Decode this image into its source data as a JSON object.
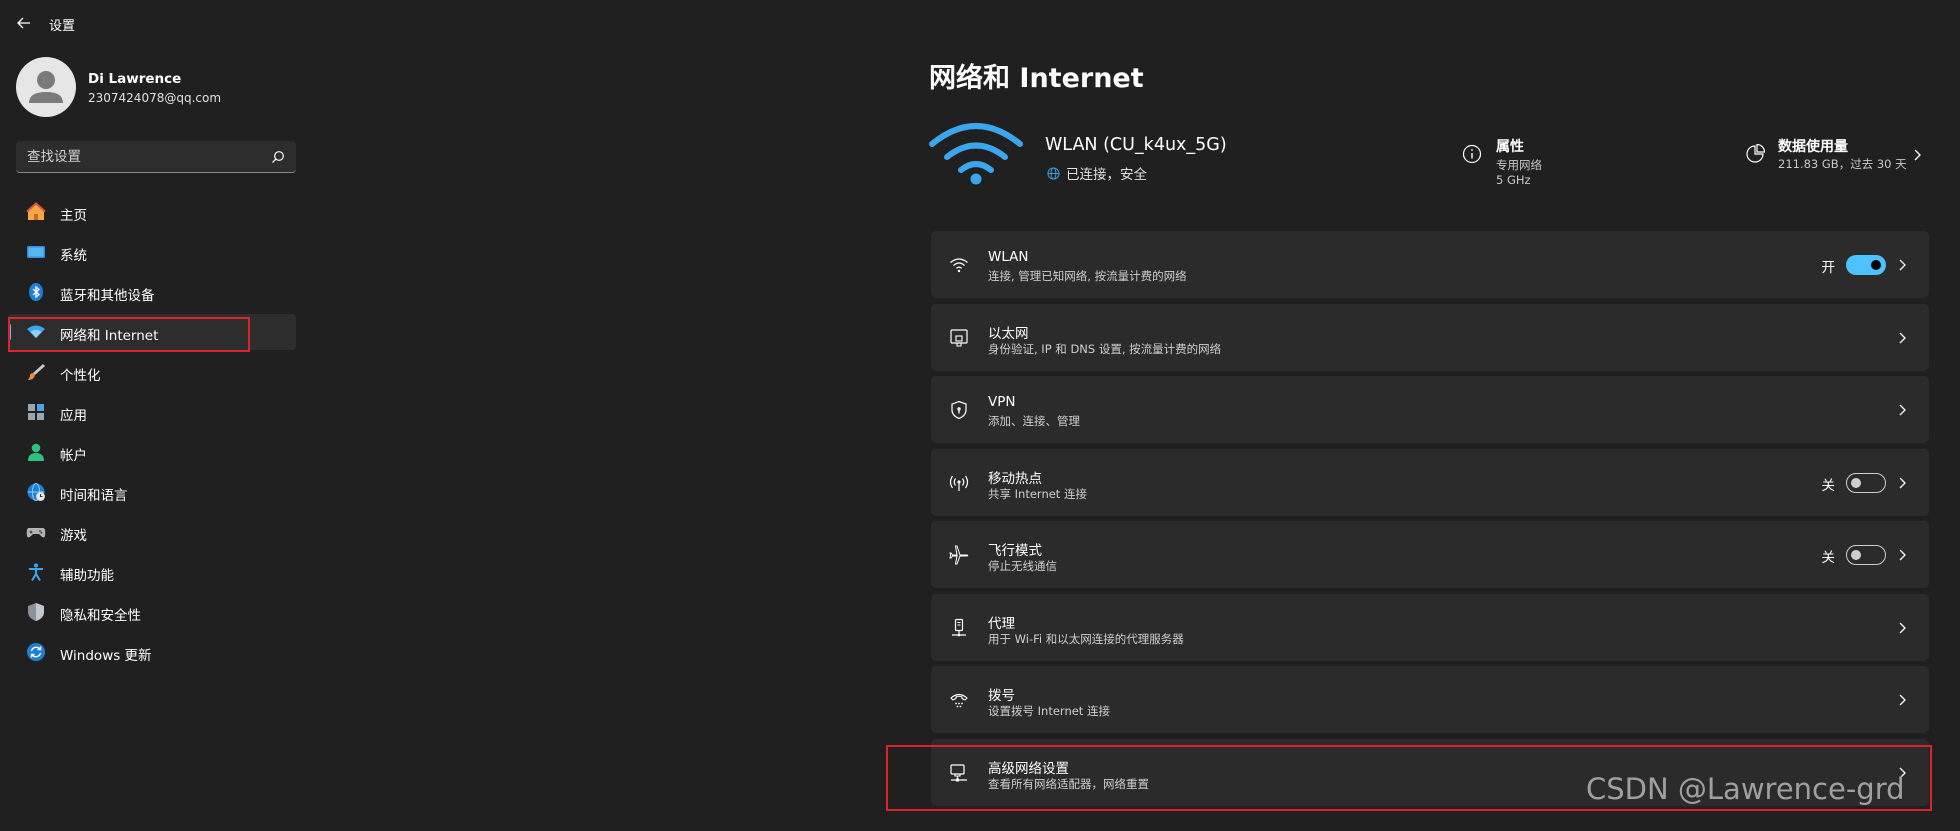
{
  "app": {
    "title": "设置"
  },
  "user": {
    "name": "Di Lawrence",
    "email": "2307424078@qq.com"
  },
  "search": {
    "placeholder": "查找设置"
  },
  "nav": {
    "items": [
      {
        "label": "主页",
        "icon": "home-icon"
      },
      {
        "label": "系统",
        "icon": "system-icon"
      },
      {
        "label": "蓝牙和其他设备",
        "icon": "bluetooth-icon"
      },
      {
        "label": "网络和 Internet",
        "icon": "network-icon",
        "active": true
      },
      {
        "label": "个性化",
        "icon": "brush-icon"
      },
      {
        "label": "应用",
        "icon": "apps-icon"
      },
      {
        "label": "帐户",
        "icon": "account-icon"
      },
      {
        "label": "时间和语言",
        "icon": "globe-clock-icon"
      },
      {
        "label": "游戏",
        "icon": "gamepad-icon"
      },
      {
        "label": "辅助功能",
        "icon": "accessibility-icon"
      },
      {
        "label": "隐私和安全性",
        "icon": "shield-icon"
      },
      {
        "label": "Windows 更新",
        "icon": "update-icon"
      }
    ]
  },
  "main": {
    "title": "网络和 Internet",
    "connection": {
      "name": "WLAN (CU_k4ux_5G)",
      "status": "已连接，安全"
    },
    "properties": {
      "title": "属性",
      "line1": "专用网络",
      "line2": "5 GHz"
    },
    "data_usage": {
      "title": "数据使用量",
      "value": "211.83 GB，过去 30 天"
    },
    "cards": [
      {
        "title": "WLAN",
        "subtitle": "连接, 管理已知网络, 按流量计费的网络",
        "icon": "wifi-icon",
        "toggle": true,
        "toggle_on": true,
        "toggle_label": "开"
      },
      {
        "title": "以太网",
        "subtitle": "身份验证, IP 和 DNS 设置, 按流量计费的网络",
        "icon": "ethernet-icon"
      },
      {
        "title": "VPN",
        "subtitle": "添加、连接、管理",
        "icon": "vpn-shield-icon"
      },
      {
        "title": "移动热点",
        "subtitle": "共享 Internet 连接",
        "icon": "hotspot-icon",
        "toggle": true,
        "toggle_on": false,
        "toggle_label": "关"
      },
      {
        "title": "飞行模式",
        "subtitle": "停止无线通信",
        "icon": "airplane-icon",
        "toggle": true,
        "toggle_on": false,
        "toggle_label": "关"
      },
      {
        "title": "代理",
        "subtitle": "用于 Wi-Fi 和以太网连接的代理服务器",
        "icon": "proxy-icon"
      },
      {
        "title": "拨号",
        "subtitle": "设置拨号 Internet 连接",
        "icon": "dialup-icon"
      },
      {
        "title": "高级网络设置",
        "subtitle": "查看所有网络适配器，网络重置",
        "icon": "advanced-network-icon"
      }
    ]
  },
  "watermark": "CSDN @Lawrence-grd",
  "colors": {
    "accent": "#4cc2ff",
    "highlight_box": "#d9262c",
    "background": "#202020",
    "card": "#2b2b2b"
  }
}
